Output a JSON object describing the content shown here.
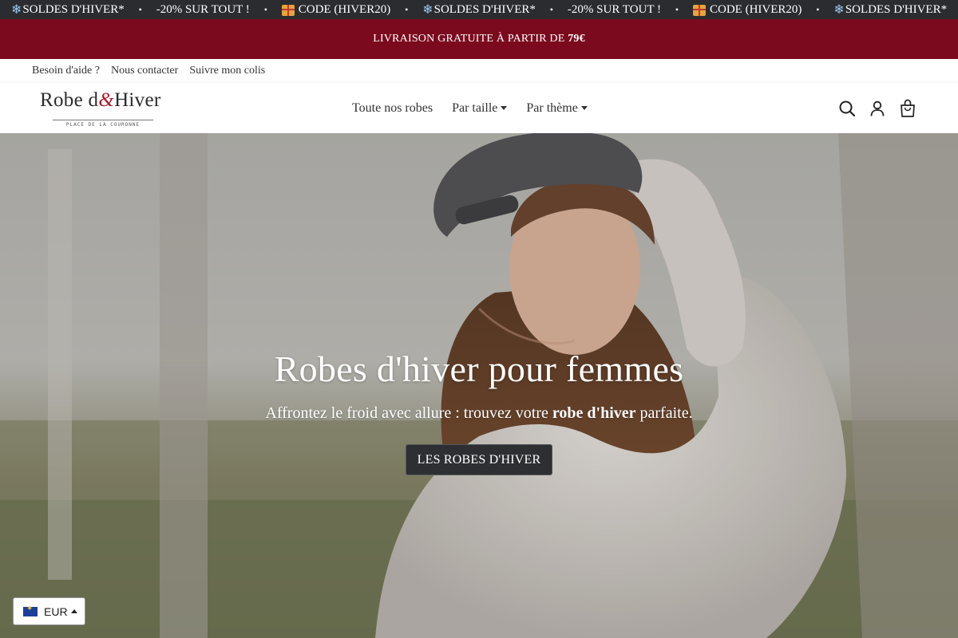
{
  "ticker": {
    "items": [
      {
        "type": "snow",
        "text": "SOLDES D'HIVER*"
      },
      {
        "type": "plain",
        "text": "-20% SUR TOUT !"
      },
      {
        "type": "gift",
        "text": "CODE (HIVER20)"
      },
      {
        "type": "snow",
        "text": "SOLDES D'HIVER*"
      },
      {
        "type": "plain",
        "text": "-20% SUR TOUT !"
      },
      {
        "type": "gift",
        "text": "CODE (HIVER20)"
      },
      {
        "type": "snow",
        "text": "SOLDES D'HIVER*"
      }
    ],
    "separator": "•",
    "snow_glyph": "❄"
  },
  "promo": {
    "text": "LIVRAISON GRATUITE À PARTIR DE ",
    "amount": "79€"
  },
  "util_links": [
    "Besoin d'aide ?",
    "Nous contacter",
    "Suivre mon colis"
  ],
  "logo": {
    "left": "Robe d",
    "amp": "&",
    "right": "Hiver",
    "tagline": "PLACE DE LA COURONNE"
  },
  "nav": {
    "all_dresses": "Toute nos robes",
    "by_size": "Par taille",
    "by_theme": "Par thème"
  },
  "header_icons": [
    "search-icon",
    "account-icon",
    "cart-bag-icon"
  ],
  "hero": {
    "title": "Robes d'hiver pour femmes",
    "subtitle_before": "Affrontez le froid avec allure : trouvez votre ",
    "subtitle_bold": "robe d'hiver",
    "subtitle_after": " parfaite.",
    "cta": "LES ROBES D'HIVER"
  },
  "currency": {
    "code": "EUR",
    "flag": "eu-flag-icon"
  },
  "colors": {
    "ticker_bg": "#2a2c30",
    "promo_bg": "#7b0a1e",
    "accent": "#b0152b",
    "cta_bg": "#2d2f33"
  }
}
